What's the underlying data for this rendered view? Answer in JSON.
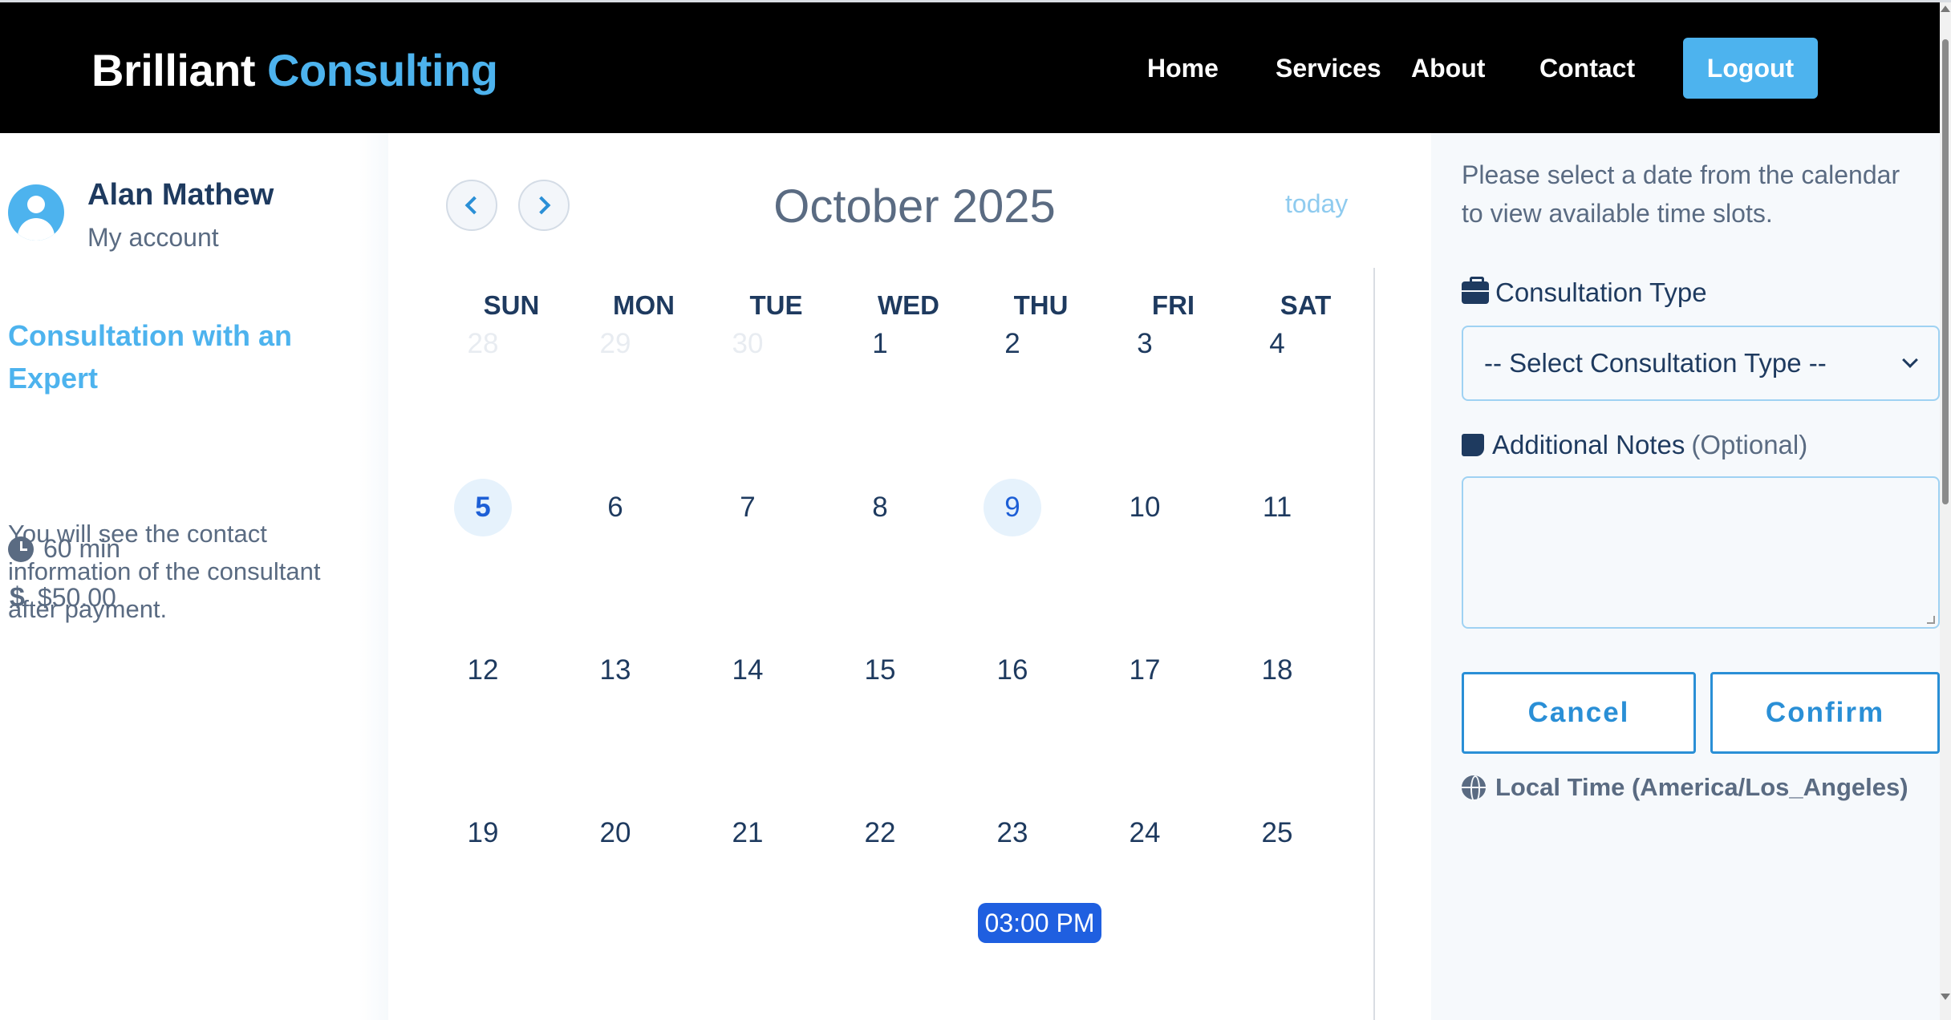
{
  "header": {
    "brand_primary": "Brilliant",
    "brand_accent": "Consulting",
    "nav": [
      "Home",
      "Services",
      "About",
      "Contact"
    ],
    "logout_label": "Logout"
  },
  "sidebar": {
    "user_name": "Alan Mathew",
    "account_label": "My account",
    "service_title": "Consultation with an Expert",
    "duration": "60 min",
    "price": "$50.00",
    "description": "You will see the contact information of the consultant after payment."
  },
  "calendar": {
    "title": "October 2025",
    "today_label": "today",
    "weekdays": [
      "SUN",
      "MON",
      "TUE",
      "WED",
      "THU",
      "FRI",
      "SAT"
    ],
    "weeks": [
      [
        "28",
        "29",
        "30",
        "1",
        "2",
        "3",
        "4"
      ],
      [
        "5",
        "6",
        "7",
        "8",
        "9",
        "10",
        "11"
      ],
      [
        "12",
        "13",
        "14",
        "15",
        "16",
        "17",
        "18"
      ],
      [
        "19",
        "20",
        "21",
        "22",
        "23",
        "24",
        "25"
      ]
    ],
    "muted_days": [
      "28",
      "29",
      "30"
    ],
    "highlighted_days": [
      "5",
      "9"
    ],
    "slot_label": "03:00 PM",
    "slot_day": "23"
  },
  "booking": {
    "hint": "Please select a date from the calendar to view available time slots.",
    "consultation_type_label": "Consultation Type",
    "consultation_type_placeholder": "-- Select Consultation Type --",
    "notes_label": "Additional Notes",
    "notes_optional": "(Optional)",
    "notes_value": "",
    "cancel_label": "Cancel",
    "confirm_label": "Confirm",
    "timezone_label": "Local Time (America/Los_Angeles)"
  },
  "colors": {
    "accent": "#4db3ee",
    "primary_text": "#1e3a5f",
    "secondary_text": "#5a6b82",
    "slot_blue": "#1f5fe0",
    "header_bg": "#000000"
  }
}
